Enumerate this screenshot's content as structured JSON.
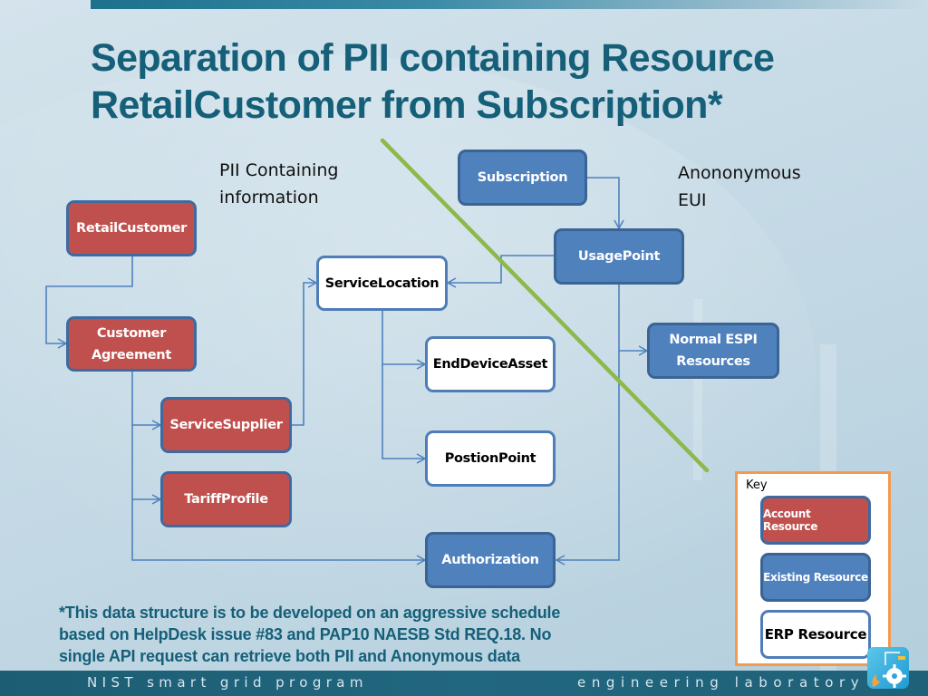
{
  "slide": {
    "title": "Separation of PII containing Resource RetailCustomer from Subscription*",
    "title_line1": "Separation of PII containing Resource",
    "title_line2": "RetailCustomer from Subscription*",
    "region_labels": {
      "pii_line1": "PII Containing",
      "pii_line2": "information",
      "anon_line1": "Anononymous",
      "anon_line2": "EUI"
    },
    "colors": {
      "title": "#155f78",
      "account_resource": "#c0504d",
      "existing_resource": "#4f81bd",
      "erp_resource": "#ffffff",
      "connector": "#4f81bd",
      "divider": "#8db84a",
      "key_border": "#f39a4f",
      "footer_bar": "#1f6178"
    },
    "nodes": {
      "retail_customer": {
        "label": "RetailCustomer",
        "type": "account"
      },
      "customer_agreement": {
        "line1": "Customer",
        "line2": "Agreement",
        "type": "account"
      },
      "service_supplier": {
        "label": "ServiceSupplier",
        "type": "account"
      },
      "tariff_profile": {
        "label": "TariffProfile",
        "type": "account"
      },
      "service_location": {
        "label": "ServiceLocation",
        "type": "erp"
      },
      "end_device_asset": {
        "label": "EndDeviceAsset",
        "type": "erp"
      },
      "position_point": {
        "label": "PostionPoint",
        "type": "erp"
      },
      "subscription": {
        "label": "Subscription",
        "type": "existing"
      },
      "usage_point": {
        "label": "UsagePoint",
        "type": "existing"
      },
      "normal_espi": {
        "line1": "Normal ESPI",
        "line2": "Resources",
        "type": "existing"
      },
      "authorization": {
        "label": "Authorization",
        "type": "existing"
      }
    },
    "edges": [
      {
        "from": "RetailCustomer",
        "to": "Customer Agreement"
      },
      {
        "from": "Customer Agreement",
        "to": "ServiceSupplier"
      },
      {
        "from": "Customer Agreement",
        "to": "TariffProfile"
      },
      {
        "from": "Customer Agreement",
        "to": "Authorization"
      },
      {
        "from": "ServiceSupplier",
        "to": "ServiceLocation"
      },
      {
        "from": "ServiceLocation",
        "to": "EndDeviceAsset"
      },
      {
        "from": "ServiceLocation",
        "to": "PostionPoint"
      },
      {
        "from": "Subscription",
        "to": "UsagePoint"
      },
      {
        "from": "UsagePoint",
        "to": "ServiceLocation"
      },
      {
        "from": "UsagePoint",
        "to": "Normal ESPI Resources"
      },
      {
        "from": "UsagePoint",
        "to": "Authorization"
      }
    ],
    "key": {
      "title": "Key",
      "account": "Account Resource",
      "existing": "Existing Resource",
      "erp": "ERP Resource"
    },
    "footnote": {
      "line1": "*This data structure is to be developed on an aggressive schedule",
      "line2": "based on HelpDesk issue #83 and PAP10 NAESB Std REQ.18. No",
      "line3": "single API request can retrieve both PII and Anonymous data"
    },
    "footer": {
      "left": "NIST smart grid program",
      "right": "engineering laboratory",
      "logo": "engineering-lab-logo-icon"
    }
  }
}
